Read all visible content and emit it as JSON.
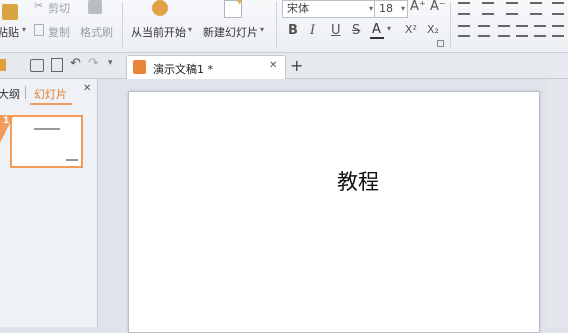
{
  "ribbon": {
    "paste_label": "粘贴",
    "cut_label": "剪切",
    "copy_label": "复制",
    "format_painter_label": "格式刷",
    "play_from_current_label": "从当前开始",
    "new_slide_label": "新建幻灯片",
    "font_name": "宋体",
    "font_size": "18",
    "bold": "B",
    "italic": "I",
    "underline": "U",
    "strike": "S",
    "font_color": "A",
    "superscript": "X²",
    "subscript": "X₂",
    "grow_font": "A⁺",
    "shrink_font": "A⁻"
  },
  "tabs": {
    "doc_title": "演示文稿1 *",
    "close_glyph": "✕",
    "new_tab_glyph": "+"
  },
  "panel": {
    "outline_tab": "大纲",
    "slides_tab": "幻灯片",
    "close_glyph": "✕",
    "slide_number": "1"
  },
  "slide": {
    "text": "教程"
  },
  "colors": {
    "accent": "#f29c5c",
    "slides_tab_text": "#e07b2e"
  }
}
